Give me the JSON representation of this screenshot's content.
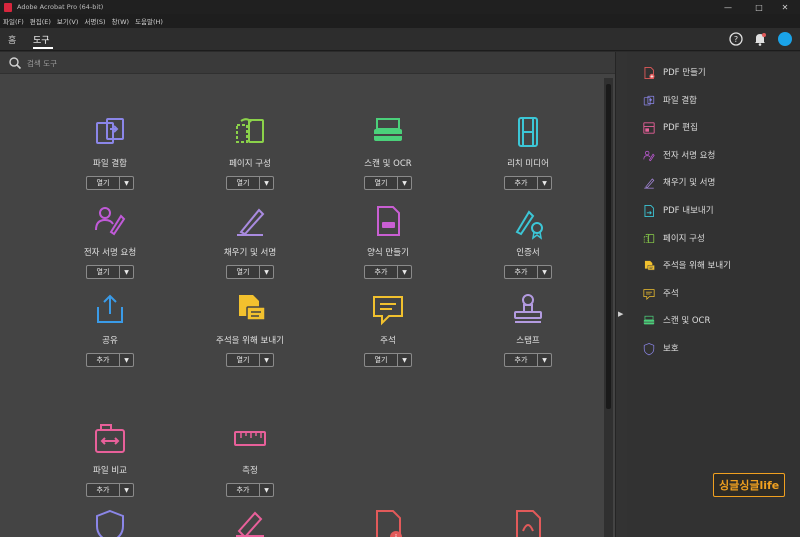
{
  "window": {
    "title": "Adobe Acrobat Pro (64-bit)",
    "minimize": "—",
    "maximize": "□",
    "close": "✕"
  },
  "menu": [
    "파일(F)",
    "편집(E)",
    "보기(V)",
    "서명(S)",
    "창(W)",
    "도움말(H)"
  ],
  "tabs": {
    "home": "홈",
    "tools": "도구"
  },
  "search": {
    "placeholder": "검색 도구"
  },
  "colors": {
    "accent": "#1aa3e8",
    "watermark": "#f0a020"
  },
  "tools": [
    {
      "label": "파일 결합",
      "button": "열기",
      "icon": "combine-files-icon",
      "color": "#8b86e8"
    },
    {
      "label": "페이지 구성",
      "button": "열기",
      "icon": "organize-pages-icon",
      "color": "#8bd24a"
    },
    {
      "label": "스캔 및 OCR",
      "button": "열기",
      "icon": "scan-icon",
      "color": "#4bd07a"
    },
    {
      "label": "리치 미디어",
      "button": "추가",
      "icon": "rich-media-icon",
      "color": "#3cc6d6"
    },
    {
      "label": "전자 서명 요청",
      "button": "열기",
      "icon": "request-signature-icon",
      "color": "#c05ad8"
    },
    {
      "label": "채우기 및 서명",
      "button": "열기",
      "icon": "fill-sign-icon",
      "color": "#a98be0"
    },
    {
      "label": "양식 만들기",
      "button": "추가",
      "icon": "prepare-form-icon",
      "color": "#c95fd3"
    },
    {
      "label": "인증서",
      "button": "추가",
      "icon": "certificates-icon",
      "color": "#3cc6d6"
    },
    {
      "label": "공유",
      "button": "추가",
      "icon": "share-icon",
      "color": "#3a9be8"
    },
    {
      "label": "주석을 위해 보내기",
      "button": "열기",
      "icon": "send-for-comments-icon",
      "color": "#f2c12e"
    },
    {
      "label": "주석",
      "button": "열기",
      "icon": "comment-icon",
      "color": "#f2c12e"
    },
    {
      "label": "스탬프",
      "button": "추가",
      "icon": "stamp-icon",
      "color": "#b39be0"
    },
    {
      "label": "파일 비교",
      "button": "추가",
      "icon": "compare-files-icon",
      "color": "#e8609a"
    },
    {
      "label": "측정",
      "button": "추가",
      "icon": "measure-icon",
      "color": "#e8609a"
    }
  ],
  "more_tools": [
    {
      "icon": "protect-icon",
      "color": "#8b86e8"
    },
    {
      "icon": "redact-icon",
      "color": "#e8609a"
    },
    {
      "icon": "pdf-standards-icon",
      "color": "#e25a5a"
    },
    {
      "icon": "print-production-icon",
      "color": "#e25a5a"
    }
  ],
  "right_panel": [
    {
      "label": "PDF 만들기",
      "icon": "create-pdf-icon",
      "color": "#e25a5a"
    },
    {
      "label": "파일 결합",
      "icon": "combine-files-icon",
      "color": "#8b86e8"
    },
    {
      "label": "PDF 편집",
      "icon": "edit-pdf-icon",
      "color": "#e8609a"
    },
    {
      "label": "전자 서명 요청",
      "icon": "request-signature-icon",
      "color": "#c05ad8"
    },
    {
      "label": "채우기 및 서명",
      "icon": "fill-sign-icon",
      "color": "#a98be0"
    },
    {
      "label": "PDF 내보내기",
      "icon": "export-pdf-icon",
      "color": "#3cc6d6"
    },
    {
      "label": "페이지 구성",
      "icon": "organize-pages-icon",
      "color": "#8bd24a"
    },
    {
      "label": "주석을 위해 보내기",
      "icon": "send-for-comments-icon",
      "color": "#f2c12e"
    },
    {
      "label": "주석",
      "icon": "comment-icon",
      "color": "#f2c12e"
    },
    {
      "label": "스캔 및 OCR",
      "icon": "scan-icon",
      "color": "#4bd07a"
    },
    {
      "label": "보호",
      "icon": "protect-icon",
      "color": "#8b86e8"
    }
  ],
  "watermark": "싱글싱글life"
}
